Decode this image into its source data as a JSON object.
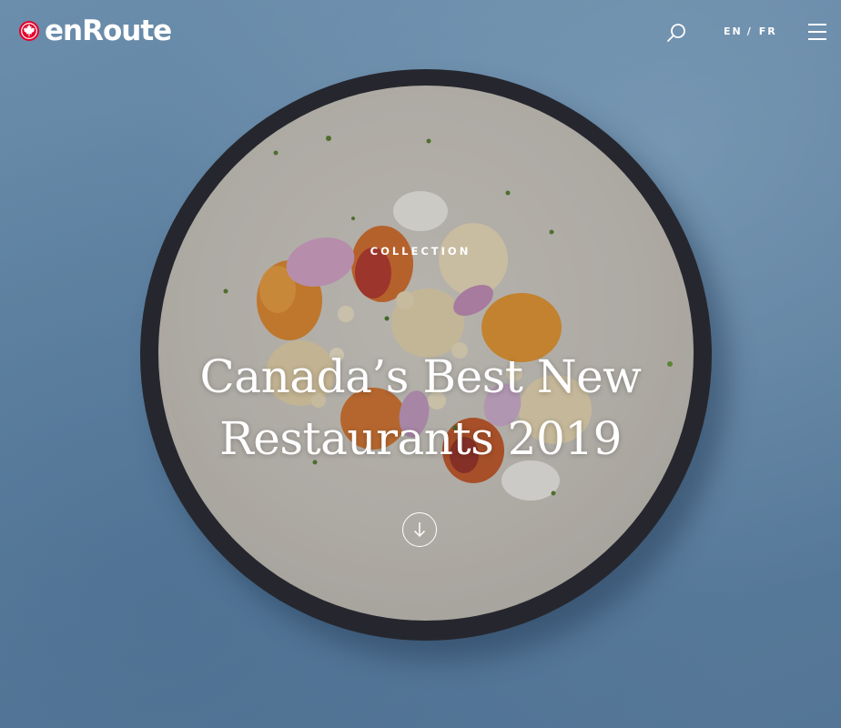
{
  "header": {
    "logo_text": "enRoute",
    "languages": [
      "EN",
      "FR"
    ],
    "language_separator": "/"
  },
  "hero": {
    "eyebrow": "COLLECTION",
    "headline_line1": "Canada’s Best New",
    "headline_line2": "Restaurants 2019"
  },
  "icons": {
    "logo": "maple-leaf-roundel-icon",
    "search": "search-icon",
    "menu": "hamburger-menu-icon",
    "scroll": "arrow-down-circle-icon"
  },
  "colors": {
    "brand_red": "#e4002b",
    "text": "#ffffff",
    "background_blue": "#6f97b8"
  }
}
